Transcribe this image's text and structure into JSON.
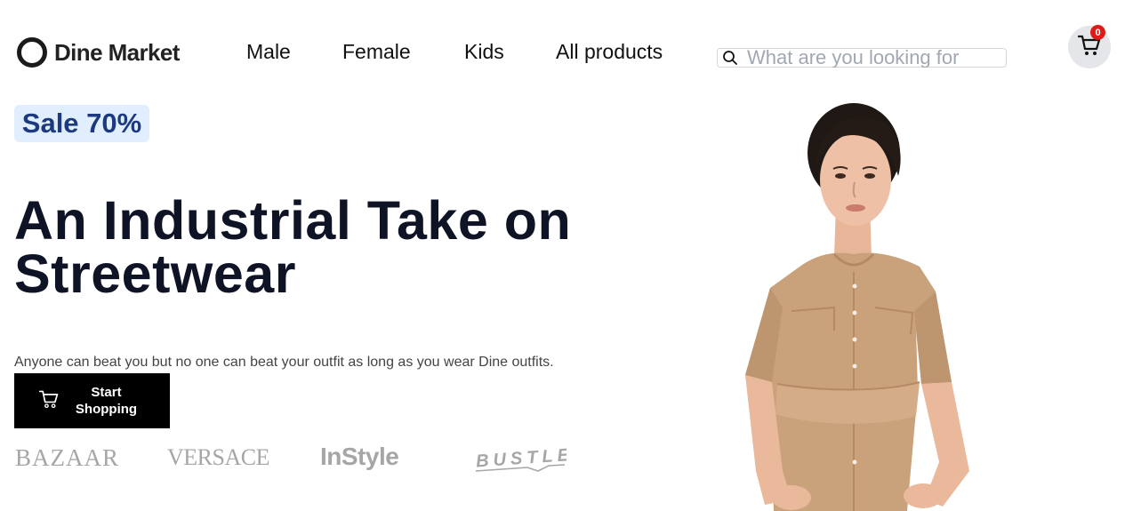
{
  "header": {
    "logo_text": "Dine Market",
    "nav": [
      "Male",
      "Female",
      "Kids",
      "All products"
    ],
    "search_placeholder": "What are you looking for",
    "cart_count": "0"
  },
  "hero": {
    "badge": "Sale 70%",
    "title": "An Industrial Take on Streetwear",
    "subtitle": "Anyone can beat you but no one can beat your outfit as long as you wear Dine outfits.",
    "cta_label": "Start Shopping"
  },
  "featured_brands": [
    "BAZAAR",
    "VERSACE",
    "InStyle",
    "BUSTLE"
  ],
  "icons": {
    "search": "search-icon",
    "cart": "cart-icon",
    "cta": "cart-icon"
  },
  "colors": {
    "badge_bg": "#e0eefe",
    "badge_text": "#1d3a80",
    "cart_badge": "#e01919",
    "cta_bg": "#000000"
  }
}
